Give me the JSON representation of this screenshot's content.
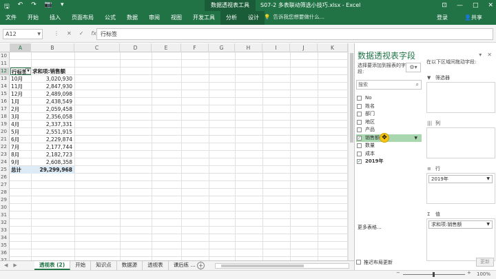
{
  "titlebar": {
    "qat": [
      "save-icon",
      "undo-icon",
      "redo-icon",
      "camera-icon",
      "customize-icon"
    ],
    "qat_glyphs": [
      "🖫",
      "↶",
      "↷",
      "📷",
      "▾"
    ],
    "context_title": "数据透视表工具",
    "doc_title": "S07-2 多表联动筛选小技巧.xlsx - Excel",
    "controls": [
      "⊡",
      "—",
      "□",
      "✕"
    ]
  },
  "ribbon": {
    "tabs": [
      "文件",
      "开始",
      "插入",
      "页面布局",
      "公式",
      "数据",
      "审阅",
      "视图",
      "开发工具",
      "分析",
      "设计"
    ],
    "tell_me": "告诉我您想要做什么...",
    "login": "登录",
    "share": "共享"
  },
  "formula_bar": {
    "name_box": "A12",
    "icons": [
      "⋮",
      "✕",
      "✓",
      "fx"
    ],
    "content": "行标签"
  },
  "grid": {
    "columns": [
      "A",
      "B",
      "C",
      "D",
      "E",
      "F",
      "G",
      "H",
      "I",
      "J",
      "K"
    ],
    "rows": [
      {
        "n": "10",
        "a": "",
        "b": ""
      },
      {
        "n": "11",
        "a": "",
        "b": ""
      },
      {
        "n": "12",
        "a": "行标签",
        "b": "求和项:销售额",
        "kind": "header"
      },
      {
        "n": "13",
        "a": "10月",
        "b": "3,020,930"
      },
      {
        "n": "14",
        "a": "11月",
        "b": "2,847,930"
      },
      {
        "n": "15",
        "a": "12月",
        "b": "2,489,098"
      },
      {
        "n": "16",
        "a": "1月",
        "b": "2,438,549"
      },
      {
        "n": "17",
        "a": "2月",
        "b": "2,059,458"
      },
      {
        "n": "18",
        "a": "3月",
        "b": "2,356,058"
      },
      {
        "n": "19",
        "a": "4月",
        "b": "2,337,331"
      },
      {
        "n": "20",
        "a": "5月",
        "b": "2,551,915"
      },
      {
        "n": "21",
        "a": "6月",
        "b": "2,229,874"
      },
      {
        "n": "22",
        "a": "7月",
        "b": "2,177,744"
      },
      {
        "n": "23",
        "a": "8月",
        "b": "2,182,723"
      },
      {
        "n": "24",
        "a": "9月",
        "b": "2,608,358"
      },
      {
        "n": "25",
        "a": "总计",
        "b": "29,299,968",
        "kind": "total"
      },
      {
        "n": "26",
        "a": "",
        "b": ""
      },
      {
        "n": "27",
        "a": "",
        "b": ""
      },
      {
        "n": "28",
        "a": "",
        "b": ""
      },
      {
        "n": "29",
        "a": "",
        "b": ""
      },
      {
        "n": "30",
        "a": "",
        "b": ""
      },
      {
        "n": "31",
        "a": "",
        "b": ""
      },
      {
        "n": "32",
        "a": "",
        "b": ""
      },
      {
        "n": "33",
        "a": "",
        "b": ""
      },
      {
        "n": "34",
        "a": "",
        "b": ""
      },
      {
        "n": "35",
        "a": "",
        "b": ""
      },
      {
        "n": "36",
        "a": "",
        "b": ""
      },
      {
        "n": "37",
        "a": "",
        "b": ""
      }
    ]
  },
  "sheets": {
    "tabs": [
      "透视表 (2)",
      "开始",
      "知识点",
      "数据源",
      "透视表",
      "课后练 ..."
    ],
    "active": 0,
    "add": "+"
  },
  "status": {
    "zoom": "100%",
    "minus": "−",
    "plus": "+"
  },
  "pivot_pane": {
    "title": "数据透视表字段",
    "subtitle": "选择要添加到报表的字段:",
    "search_placeholder": "搜索",
    "fields": [
      {
        "label": "No",
        "checked": false
      },
      {
        "label": "姓名",
        "checked": false
      },
      {
        "label": "部门",
        "checked": false
      },
      {
        "label": "地区",
        "checked": false
      },
      {
        "label": "产品",
        "checked": false
      },
      {
        "label": "销售额",
        "checked": true,
        "highlight": true
      },
      {
        "label": "数量",
        "checked": false
      },
      {
        "label": "成本",
        "checked": false
      },
      {
        "label": "2019年",
        "checked": true,
        "bold": true
      }
    ],
    "more_tables": "更多表格...",
    "areas_hint": "在以下区域间拖动字段:",
    "areas": {
      "filters": {
        "label": "筛选器",
        "items": []
      },
      "columns": {
        "label": "列",
        "items": []
      },
      "rows": {
        "label": "行",
        "items": [
          "2019年"
        ]
      },
      "values": {
        "label": "值",
        "items": [
          "求和项:销售额"
        ]
      }
    },
    "defer_label": "推迟布局更新",
    "update_label": "更新"
  }
}
